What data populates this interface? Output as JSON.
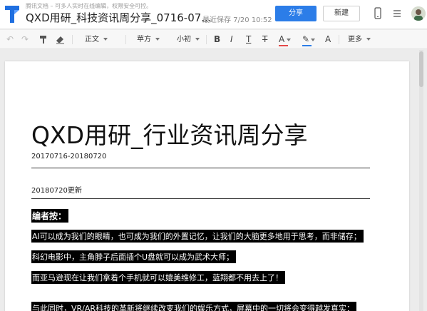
{
  "header": {
    "subtitle": "腾讯文档 – 可多人实时在线编辑，权限安全可控。",
    "doc_title": "QXD用研_科技资讯周分享_0716-07...",
    "save_status": "最近保存 7/20 10:52",
    "share_label": "分享",
    "new_label": "新建"
  },
  "toolbar": {
    "style_label": "正文",
    "font_label": "苹方",
    "size_label": "小初",
    "bold": "B",
    "italic": "I",
    "underline": "T",
    "strike": "T",
    "font_color_glyph": "A",
    "highlight_glyph": "✎",
    "clear_glyph": "A",
    "more_label": "更多",
    "font_color": "#e54848",
    "highlight_color": "#2c7de8"
  },
  "document": {
    "title": "QXD用研_行业资讯周分享",
    "date_range": "20170716-20180720",
    "update_label": "20180720更新",
    "editor_heading": "编者按：",
    "para1": "AI可以成为我们的眼睛，也可成为我们的外置记忆，让我们的大脑更多地用于思考，而非储存；",
    "para2": "科幻电影中，主角脖子后面插个U盘就可以成为武术大师；",
    "para3": "而亚马逊现在让我们拿着个手机就可以媲美维修工，蓝翔都不用去上了！",
    "para4": "与此同时，VR/AR科技的革新将继续改变我们的娱乐方式，屏幕中的一切将会变得越发真实："
  }
}
